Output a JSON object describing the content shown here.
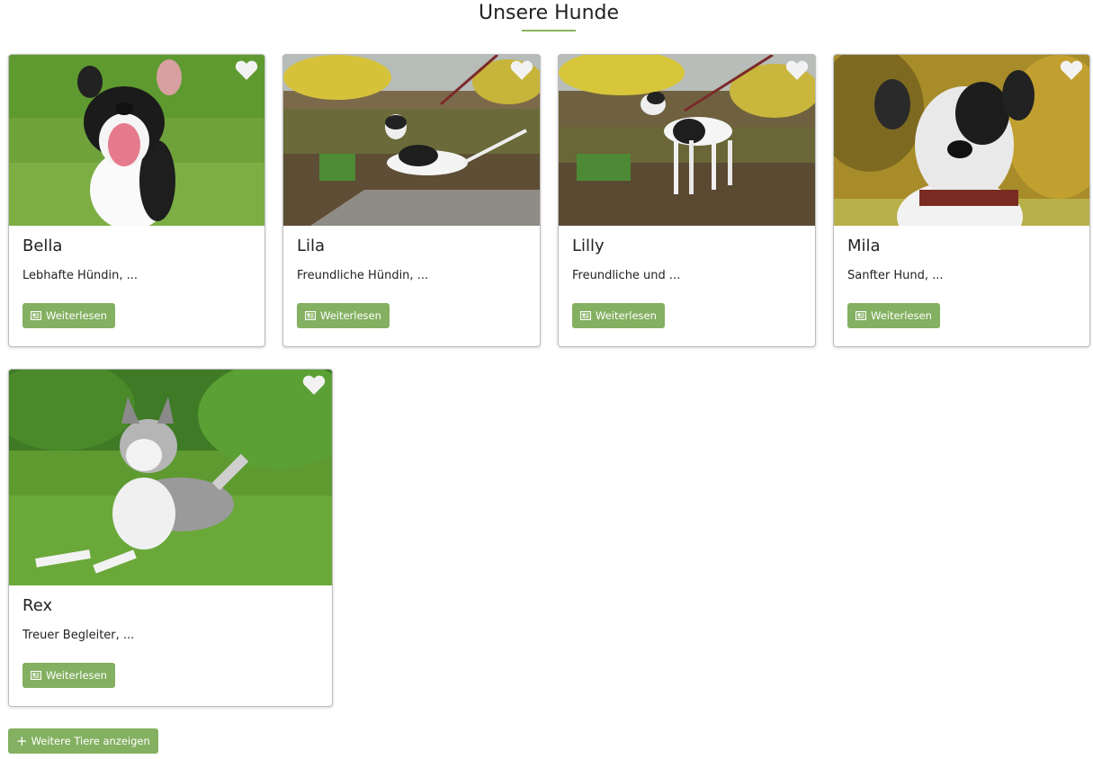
{
  "page": {
    "title": "Unsere Hunde"
  },
  "theme": {
    "accent": "#84b061",
    "heart": "#f2f2f2"
  },
  "cards": [
    {
      "name": "Bella",
      "desc": "Lebhafte Hündin, ...",
      "button": "Weiterlesen"
    },
    {
      "name": "Lila",
      "desc": "Freundliche Hündin, ...",
      "button": "Weiterlesen"
    },
    {
      "name": "Lilly",
      "desc": "Freundliche und ...",
      "button": "Weiterlesen"
    },
    {
      "name": "Mila",
      "desc": "Sanfter Hund, ...",
      "button": "Weiterlesen"
    },
    {
      "name": "Rex",
      "desc": "Treuer Begleiter, ...",
      "button": "Weiterlesen"
    }
  ],
  "more_button": {
    "label": "Weitere Tiere anzeigen",
    "icon": "plus-icon"
  },
  "icons": {
    "favorite": "heart-icon",
    "read": "newspaper-icon"
  }
}
